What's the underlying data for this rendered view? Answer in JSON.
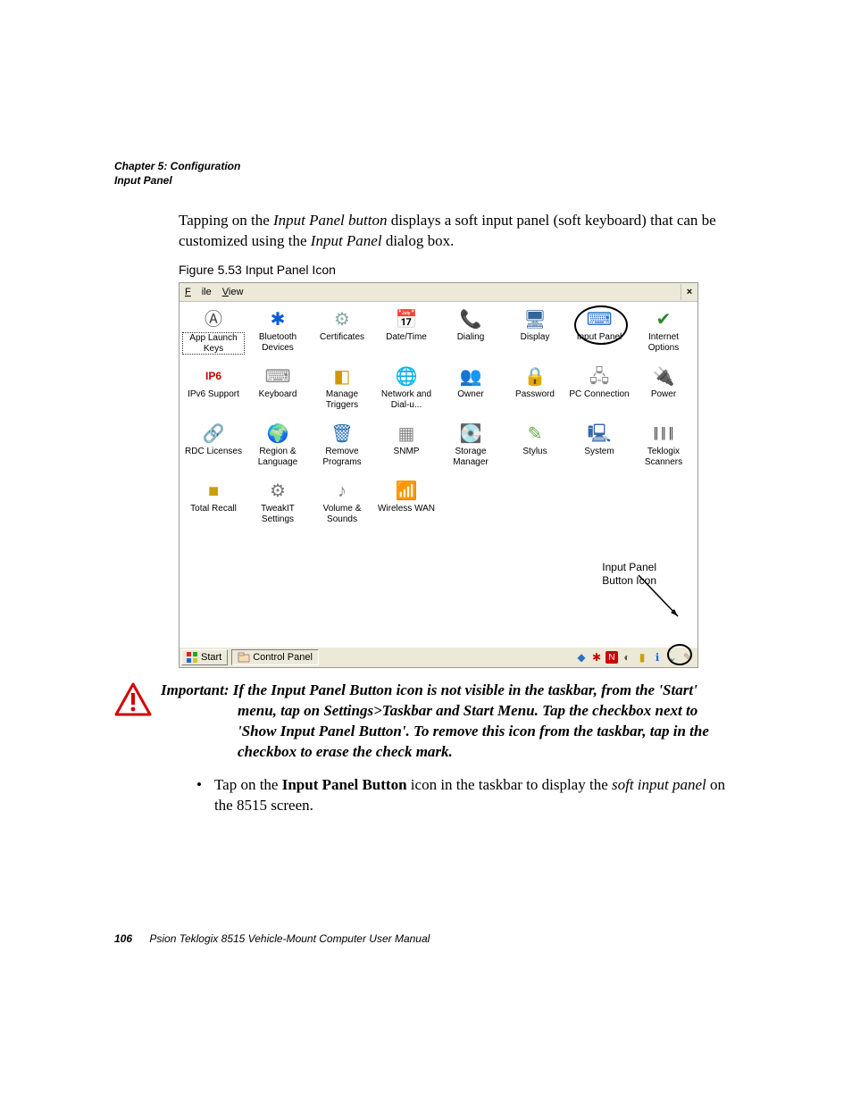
{
  "header": {
    "chapter_line": "Chapter 5: Configuration",
    "section_line": "Input Panel"
  },
  "intro": {
    "pre": "Tapping on the ",
    "em1": "Input Panel button",
    "mid": " displays a soft input panel (soft keyboard) that can be customized using the ",
    "em2": "Input Panel",
    "post": " dialog box."
  },
  "figure_caption": "Figure 5.53 Input Panel Icon",
  "screenshot": {
    "menu": {
      "file": "File",
      "view": "View"
    },
    "close": "×",
    "items": [
      {
        "label": "App Launch Keys",
        "glyph": "Ⓐ",
        "color": "#444",
        "selected": true
      },
      {
        "label": "Bluetooth Devices",
        "glyph": "✱",
        "color": "#0a5bd6"
      },
      {
        "label": "Certificates",
        "glyph": "⚙",
        "color": "#8aa"
      },
      {
        "label": "Date/Time",
        "glyph": "📅",
        "color": "#777"
      },
      {
        "label": "Dialing",
        "glyph": "📞",
        "color": "#5a8"
      },
      {
        "label": "Display",
        "glyph": "🖥",
        "color": "#369"
      },
      {
        "label": "Input Panel",
        "glyph": "⌨",
        "color": "#2a72c8",
        "highlight": true
      },
      {
        "label": "Internet Options",
        "glyph": "✔",
        "color": "#2a8a2a"
      },
      {
        "label": "IPv6 Support",
        "glyph": "IP6",
        "color": "#c00",
        "textIcon": true
      },
      {
        "label": "Keyboard",
        "glyph": "⌨",
        "color": "#888"
      },
      {
        "label": "Manage Triggers",
        "glyph": "◧",
        "color": "#cc9900"
      },
      {
        "label": "Network and Dial-u...",
        "glyph": "🌐",
        "color": "#2a6db0"
      },
      {
        "label": "Owner",
        "glyph": "👥",
        "color": "#c66"
      },
      {
        "label": "Password",
        "glyph": "🔒",
        "color": "#cca300"
      },
      {
        "label": "PC Connection",
        "glyph": "🖧",
        "color": "#888"
      },
      {
        "label": "Power",
        "glyph": "🔌",
        "color": "#b44"
      },
      {
        "label": "RDC Licenses",
        "glyph": "🔗",
        "color": "#888"
      },
      {
        "label": "Region & Language",
        "glyph": "🌍",
        "color": "#3a7"
      },
      {
        "label": "Remove Programs",
        "glyph": "🗑",
        "color": "#2a6db0"
      },
      {
        "label": "SNMP",
        "glyph": "▦",
        "color": "#888"
      },
      {
        "label": "Storage Manager",
        "glyph": "💽",
        "color": "#777"
      },
      {
        "label": "Stylus",
        "glyph": "✎",
        "color": "#6a4"
      },
      {
        "label": "System",
        "glyph": "🖳",
        "color": "#36a"
      },
      {
        "label": "Teklogix Scanners",
        "glyph": "║║║",
        "color": "#000",
        "textIcon": true
      },
      {
        "label": "Total Recall",
        "glyph": "■",
        "color": "#c9a000"
      },
      {
        "label": "TweakIT Settings",
        "glyph": "⚙",
        "color": "#777"
      },
      {
        "label": "Volume & Sounds",
        "glyph": "♪",
        "color": "#888"
      },
      {
        "label": "Wireless WAN",
        "glyph": "📶",
        "color": "#2a6db0"
      }
    ],
    "callout": {
      "line1": "Input Panel",
      "line2": "Button Icon"
    },
    "taskbar": {
      "start": "Start",
      "task": "Control Panel"
    }
  },
  "important": {
    "lead": "Important:",
    "body_first": " If the Input Panel Button icon is not visible in the taskbar, from the 'Start'",
    "body_rest_lines": [
      "menu, tap on Settings>Taskbar and Start Menu. Tap the checkbox next to",
      "'Show Input Panel Button'. To remove this icon from the taskbar, tap in the",
      "checkbox to erase the check mark."
    ]
  },
  "bullet": {
    "pre": "Tap on the ",
    "b1": "Input Panel Button",
    "mid": " icon in the taskbar to display the ",
    "em": "soft input panel",
    "post": " on the 8515 screen."
  },
  "footer": {
    "page": "106",
    "title": "Psion Teklogix 8515 Vehicle-Mount Computer User Manual"
  }
}
